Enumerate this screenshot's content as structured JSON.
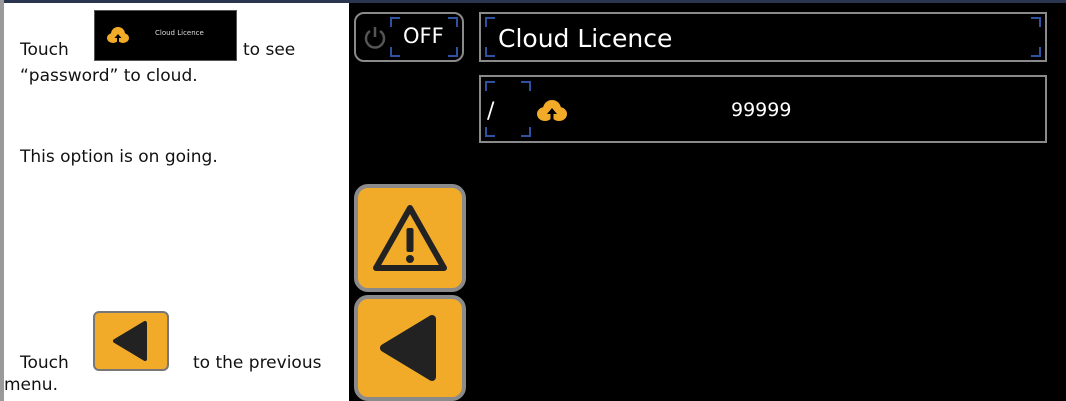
{
  "instructions": {
    "touch1": "Touch",
    "see_suffix": "to see",
    "password_line": "“password” to cloud.",
    "ongoing": "This option is on going.",
    "touch2": "Touch",
    "previous": "to the previous",
    "menu_word": "menu."
  },
  "mini_button": {
    "label": "Cloud Licence",
    "icon": "cloud-upload-icon"
  },
  "screen": {
    "power_button": {
      "label": "OFF",
      "icon": "power-icon"
    },
    "title": "Cloud Licence",
    "row": {
      "prefix": "/",
      "icon": "cloud-upload-icon",
      "value": "99999"
    },
    "warning_button": {
      "icon": "warning-icon"
    },
    "back_button": {
      "icon": "back-arrow-icon"
    }
  },
  "colors": {
    "accent": "#f2ab29",
    "screen_bg": "#000000",
    "frame": "#8a8a8a",
    "focus_bracket": "#3050a0"
  }
}
